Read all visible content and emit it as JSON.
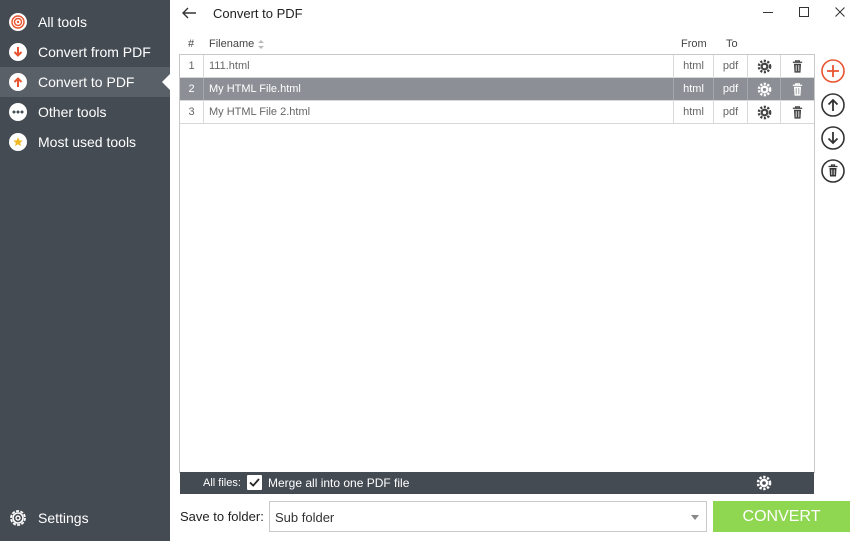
{
  "window": {
    "title": "Convert to PDF"
  },
  "sidebar": {
    "items": [
      {
        "label": "All tools",
        "icon": "target-icon"
      },
      {
        "label": "Convert from PDF",
        "icon": "arrow-down-circle-icon"
      },
      {
        "label": "Convert to PDF",
        "icon": "arrow-up-circle-icon"
      },
      {
        "label": "Other tools",
        "icon": "more-circle-icon"
      },
      {
        "label": "Most used tools",
        "icon": "star-circle-icon"
      }
    ],
    "settings_label": "Settings"
  },
  "table": {
    "headers": {
      "num": "#",
      "filename": "Filename",
      "from": "From",
      "to": "To"
    },
    "rows": [
      {
        "num": "1",
        "filename": "111.html",
        "from": "html",
        "to": "pdf"
      },
      {
        "num": "2",
        "filename": "My HTML File.html",
        "from": "html",
        "to": "pdf"
      },
      {
        "num": "3",
        "filename": "My HTML File 2.html",
        "from": "html",
        "to": "pdf"
      }
    ],
    "selected_row": 2
  },
  "all_files": {
    "label": "All files:",
    "merge_label": "Merge all into one PDF file",
    "merge_checked": true
  },
  "save": {
    "label": "Save to folder:",
    "value": "Sub folder"
  },
  "convert_label": "CONVERT",
  "colors": {
    "sidebar": "#454b53",
    "accent_add": "#e8542f",
    "convert": "#8fd651",
    "selected_row": "#8c9096"
  }
}
